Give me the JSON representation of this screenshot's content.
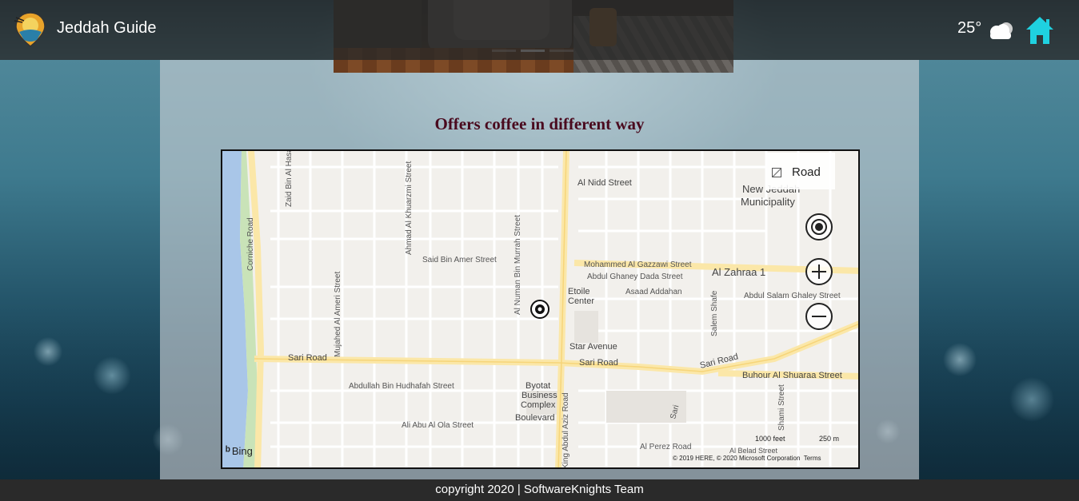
{
  "header": {
    "title": "Jeddah Guide",
    "temperature": "25°",
    "weather_icon": "cloud-icon",
    "home_icon": "home-icon"
  },
  "carousel": {
    "slides_count": 3,
    "active_index": 1
  },
  "content": {
    "heading": "Offers coffee in different way"
  },
  "map": {
    "legend_label": "Road",
    "provider": "Bing",
    "scale_feet": "1000 feet",
    "scale_meters": "250 m",
    "credits": "© 2019 HERE, © 2020 Microsoft Corporation",
    "terms": "Terms",
    "labels": {
      "zaid": "Zaid Bin Al Hasan",
      "ahmad": "Ahmad Al Khuarzmi Street",
      "corniche": "Corniche Road",
      "nidd": "Al Nidd Street",
      "new_jeddah_1": "New Jeddah",
      "new_jeddah_2": "Municipality",
      "numan": "Al Numan Bin Murrah Street",
      "said": "Said Bin Amer Street",
      "gazzawi": "Mohammed Al Gazzawi Street",
      "dada": "Abdul Ghaney Dada Street",
      "zahraa": "Al Zahraa 1",
      "mujahed": "Mujahed Al Ameri Street",
      "etoile1": "Etoile",
      "etoile2": "Center",
      "asaad": "Asaad Addahan",
      "ghaley": "Abdul Salam Ghaley Street",
      "salem": "Salem Shafe",
      "star": "Star Avenue",
      "sari_w": "Sari Road",
      "sari_c": "Sari Road",
      "sari_e": "Sari Road",
      "buhour": "Buhour Al Shuaraa Street",
      "hudhafah": "Abdullah Bin Hudhafah Street",
      "byotat1": "Byotat",
      "byotat2": "Business",
      "byotat3": "Complex",
      "byotat4": "Boulevard",
      "ola": "Ali Abu Al Ola Street",
      "king": "King Abdul Aziz Road",
      "perez": "Al Perez Road",
      "belad": "Al Belad Street",
      "shami": "Shami Street",
      "sari_small": "Sari"
    }
  },
  "footer": {
    "text": "copyright 2020 | SoftwareKnights Team"
  }
}
